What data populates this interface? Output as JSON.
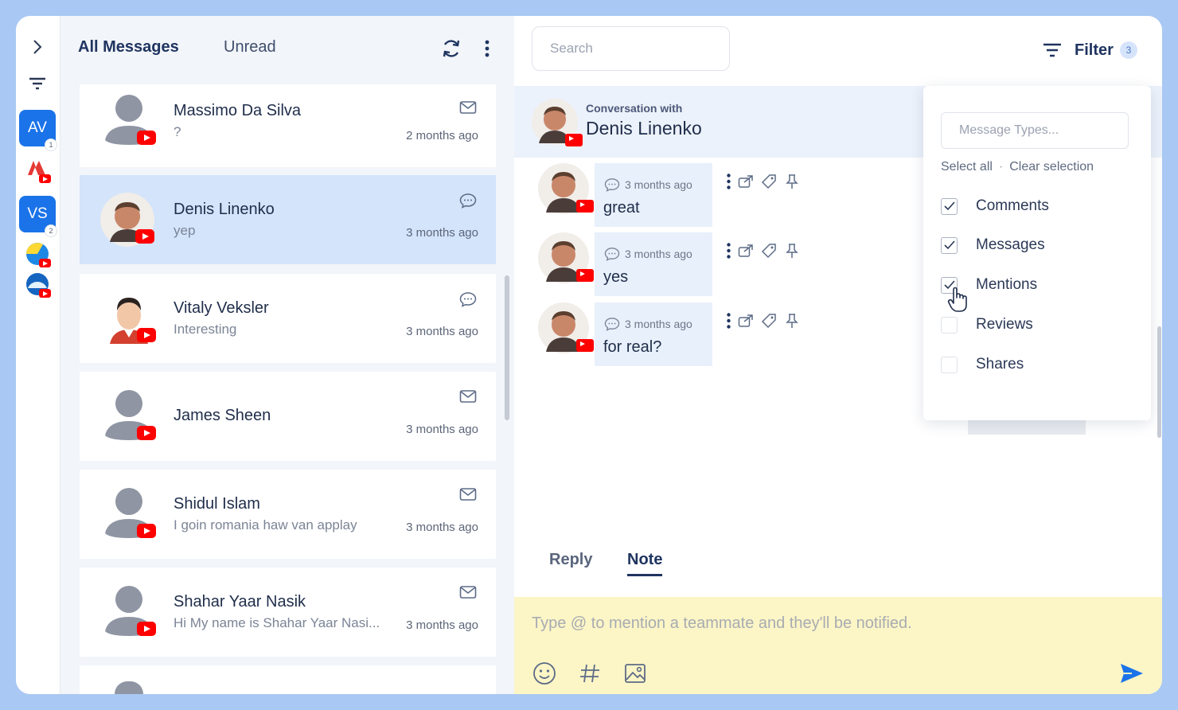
{
  "rail": {
    "accounts": [
      {
        "initials": "AV",
        "count": "1",
        "color": "#1a73e8"
      },
      {
        "initials": "VS",
        "count": "2",
        "color": "#1a73e8"
      }
    ]
  },
  "list": {
    "tabs": {
      "all": "All Messages",
      "unread": "Unread"
    },
    "items": [
      {
        "name": "Massimo Da Silva",
        "preview": "?",
        "time": "2 months ago",
        "kind": "mail-icon"
      },
      {
        "name": "Denis Linenko",
        "preview": "yep",
        "time": "3 months ago",
        "kind": "comment-icon"
      },
      {
        "name": "Vitaly Veksler",
        "preview": "Interesting",
        "time": "3 months ago",
        "kind": "comment-icon"
      },
      {
        "name": "James Sheen",
        "preview": "",
        "time": "3 months ago",
        "kind": "mail-icon"
      },
      {
        "name": "Shidul Islam",
        "preview": "I goin romania haw van applay",
        "time": "3 months ago",
        "kind": "mail-icon"
      },
      {
        "name": "Shahar Yaar Nasik",
        "preview": "Hi My name is Shahar Yaar Nasi...",
        "time": "3 months ago",
        "kind": "mail-icon"
      }
    ]
  },
  "header": {
    "search_placeholder": "Search",
    "filter_label": "Filter",
    "filter_count": "3"
  },
  "conversation": {
    "with_label": "Conversation with",
    "name": "Denis Linenko",
    "messages": [
      {
        "time": "3 months ago",
        "text": "great"
      },
      {
        "time": "3 months ago",
        "text": "yes"
      },
      {
        "time": "3 months ago",
        "text": "for real?"
      }
    ]
  },
  "composer": {
    "tabs": {
      "reply": "Reply",
      "note": "Note"
    },
    "placeholder": "Type @ to mention a teammate and they'll be notified."
  },
  "filter_menu": {
    "types_placeholder": "Message Types...",
    "select_all": "Select all",
    "separator": "·",
    "clear_selection": "Clear selection",
    "options": [
      {
        "label": "Comments",
        "checked": true
      },
      {
        "label": "Messages",
        "checked": true
      },
      {
        "label": "Mentions",
        "checked": true
      },
      {
        "label": "Reviews",
        "checked": false
      },
      {
        "label": "Shares",
        "checked": false
      }
    ]
  },
  "colors": {
    "accent": "#1a73e8",
    "selected_row": "#d3e4fb",
    "composer_bg": "#fcf5c6",
    "youtube": "#ff0000"
  }
}
